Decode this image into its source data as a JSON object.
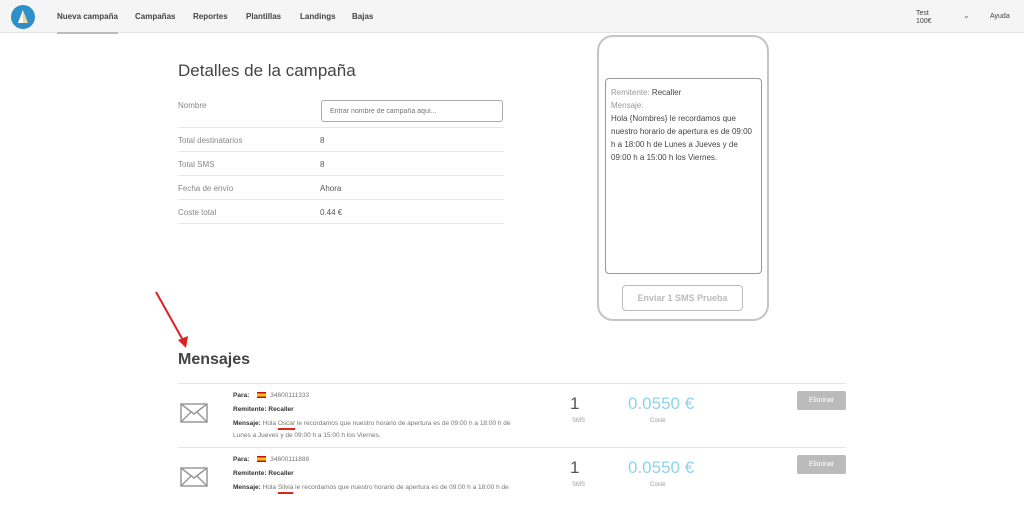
{
  "nav": {
    "items": [
      {
        "label": "Nueva campaña",
        "active": true
      },
      {
        "label": "Campañas"
      },
      {
        "label": "Reportes"
      },
      {
        "label": "Plantillas"
      },
      {
        "label": "Landings"
      },
      {
        "label": "Bajas"
      }
    ],
    "account_name": "Test",
    "account_balance": "100€",
    "help": "Ayuda"
  },
  "details": {
    "title": "Detalles de la campaña",
    "name_label": "Nombre",
    "name_placeholder": "Entrar nombre de campaña aquí...",
    "name_value": "",
    "rows": [
      {
        "label": "Total destinatarios",
        "value": "8"
      },
      {
        "label": "Total SMS",
        "value": "8"
      },
      {
        "label": "Fecha de envío",
        "value": "Ahora"
      },
      {
        "label": "Coste total",
        "value": "0.44 €"
      }
    ]
  },
  "preview": {
    "sender_label": "Remitente:",
    "sender": "Recaller",
    "message_label": "Mensaje:",
    "message": "Hola {Nombres} le recordamos que nuestro horario de apertura es de 09:00 h a 18:00 h de Lunes a Jueves y de 09:00 h a 15:00 h los Viernes.",
    "test_button": "Enviar 1 SMS Prueba"
  },
  "messages": {
    "title": "Mensajes",
    "to_label": "Para:",
    "sender_label": "Remitente:",
    "message_label": "Mensaje:",
    "sms_label": "SMS",
    "cost_label": "Coste",
    "delete_label": "Eliminar",
    "items": [
      {
        "phone": "34600111333",
        "sender": "Recaller",
        "msg_start": "Hola ",
        "name": "Oscar",
        "msg_rest_1": " le recordamos que nuestro horario de apertura es de 09:00 h a 18:00 h de",
        "msg_rest_2": "Lunes a Jueves y de 09:00 h a 15:00 h los Viernes.",
        "sms": "1",
        "cost": "0.0550 €"
      },
      {
        "phone": "34600111888",
        "sender": "Recaller",
        "msg_start": "Hola ",
        "name": "Silvia",
        "msg_rest_1": " le recordamos que nuestro horario de apertura es de 09:00 h a 18:00 h de",
        "msg_rest_2": "",
        "sms": "1",
        "cost": "0.0550 €"
      }
    ]
  },
  "annotation": {
    "arrow_color": "#e02020"
  }
}
